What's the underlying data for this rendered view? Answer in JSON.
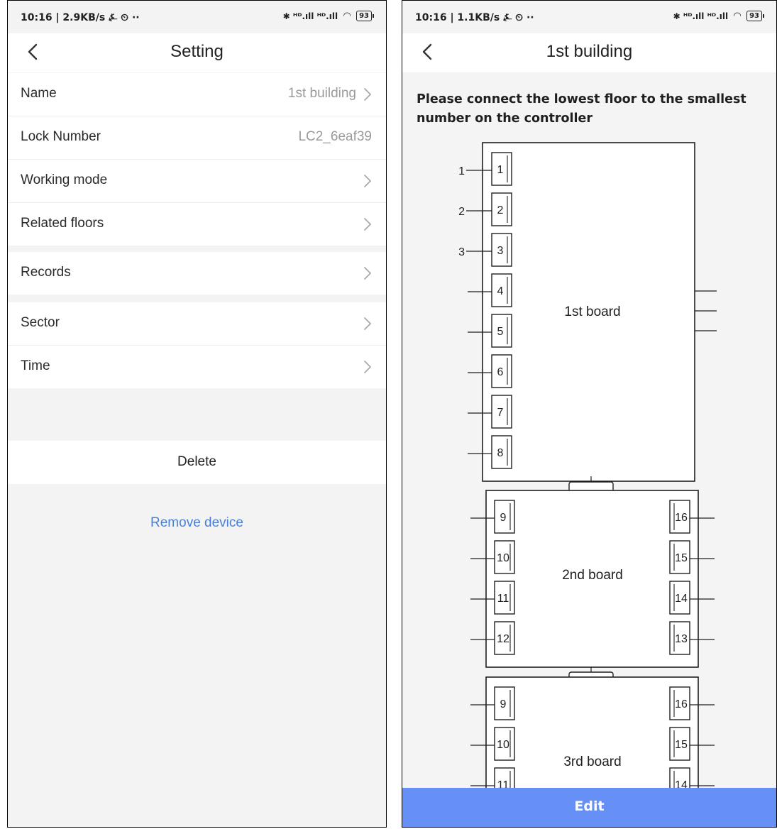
{
  "left": {
    "status": {
      "time": "10:16 | 2.9KB/s ⍼ ⏲ ··",
      "icons": "✱ ᴴᴰ.ıll ᴴᴰ.ıll",
      "battery": "93"
    },
    "title": "Setting",
    "group1": [
      {
        "label": "Name",
        "value": "1st building",
        "arrow": true
      },
      {
        "label": "Lock Number",
        "value": "LC2_6eaf39",
        "arrow": false
      },
      {
        "label": "Working mode",
        "value": "",
        "arrow": true
      },
      {
        "label": "Related floors",
        "value": "",
        "arrow": true
      }
    ],
    "group2": [
      {
        "label": "Records",
        "value": "",
        "arrow": true
      }
    ],
    "group3": [
      {
        "label": "Sector",
        "value": "",
        "arrow": true
      },
      {
        "label": "Time",
        "value": "",
        "arrow": true
      }
    ],
    "delete_label": "Delete",
    "remove_label": "Remove device"
  },
  "right": {
    "status": {
      "time": "10:16 | 1.1KB/s ⍼ ⏲ ··",
      "icons": "✱ ᴴᴰ.ıll ᴴᴰ.ıll",
      "battery": "93"
    },
    "title": "1st building",
    "instruction": "Please connect the lowest floor to the smallest number on the controller",
    "boards": [
      {
        "name": "1st board",
        "left_ports": [
          "1",
          "2",
          "3",
          "4",
          "5",
          "6",
          "7",
          "8"
        ],
        "floor_labels": [
          "1",
          "2",
          "3"
        ],
        "right_ports": []
      },
      {
        "name": "2nd board",
        "left_ports": [
          "9",
          "10",
          "11",
          "12"
        ],
        "right_ports": [
          "16",
          "15",
          "14",
          "13"
        ]
      },
      {
        "name": "3rd board",
        "left_ports": [
          "9",
          "10",
          "11"
        ],
        "right_ports": [
          "16",
          "15",
          "14"
        ]
      }
    ],
    "edit_label": "Edit"
  }
}
